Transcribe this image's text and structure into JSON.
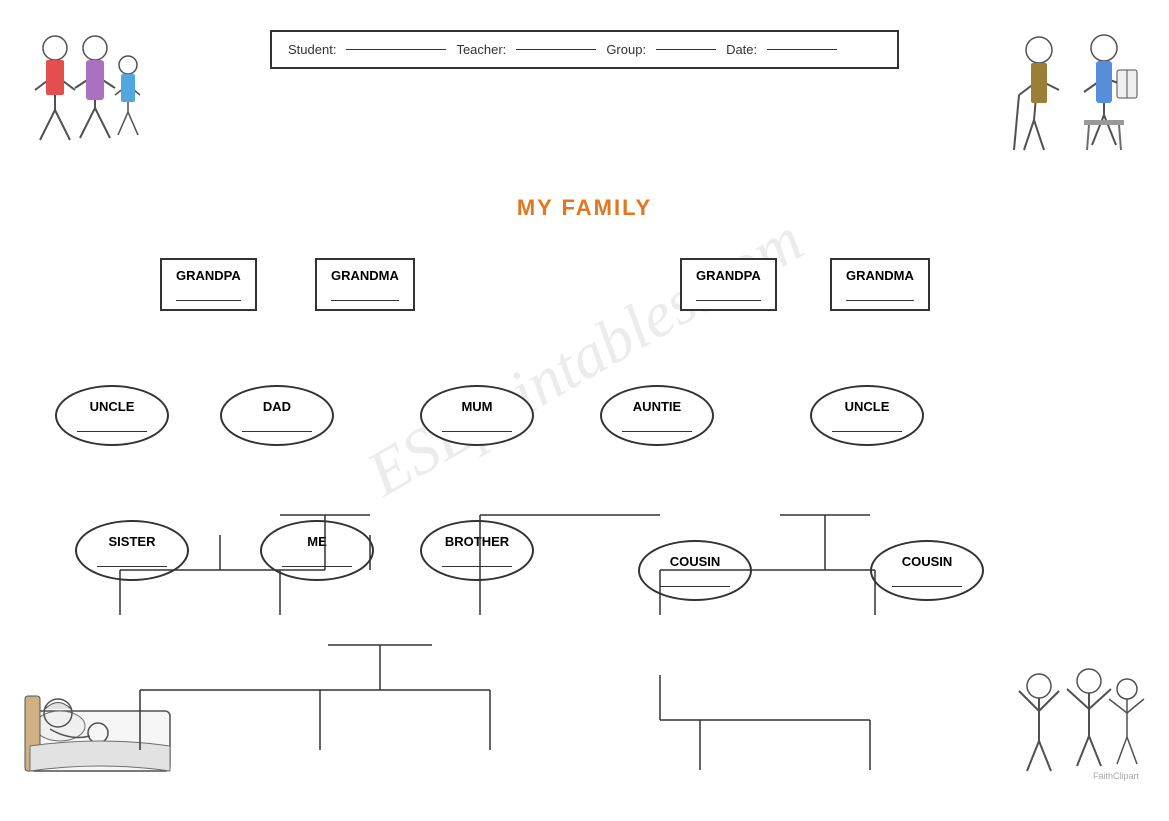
{
  "header": {
    "student_label": "Student:",
    "teacher_label": "Teacher:",
    "group_label": "Group:",
    "date_label": "Date:"
  },
  "title": "MY FAMILY",
  "watermark": "ESLprintables.com",
  "nodes": {
    "grandpa1": "GRANDPA",
    "grandma1": "GRANDMA",
    "grandpa2": "GRANDPA",
    "grandma2": "GRANDMA",
    "uncle1": "UNCLE",
    "dad": "DAD",
    "mum": "MUM",
    "auntie": "AUNTIE",
    "uncle2": "UNCLE",
    "sister": "SISTER",
    "me": "ME",
    "brother": "BROTHER",
    "cousin1": "COUSIN",
    "cousin2": "COUSIN"
  },
  "faithclippart": "FaithClipart"
}
